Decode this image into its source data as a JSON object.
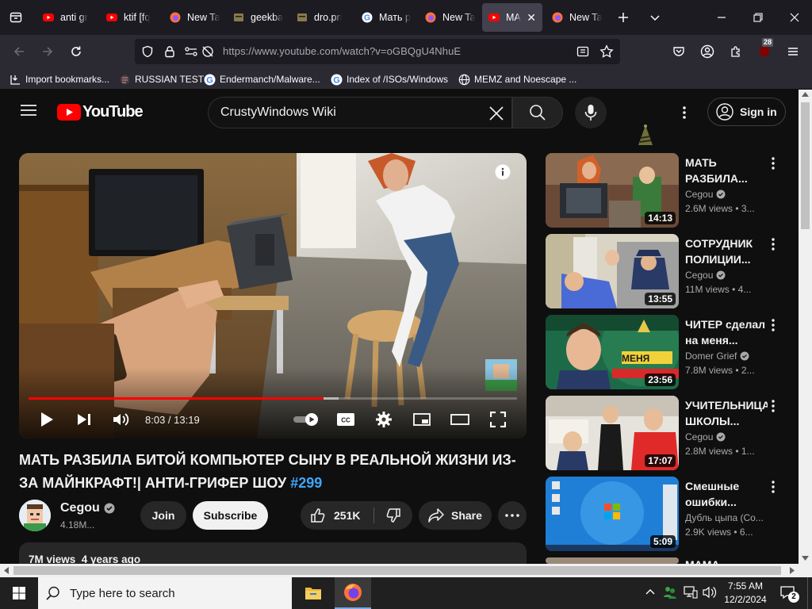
{
  "browser": {
    "tabs": [
      {
        "label": "anti gr",
        "icon": "youtube-icon"
      },
      {
        "label": "ktif [fq",
        "icon": "youtube-icon"
      },
      {
        "label": "New Ta",
        "icon": "firefox-icon"
      },
      {
        "label": "geekba",
        "icon": "page-icon"
      },
      {
        "label": "dro.pn",
        "icon": "page-icon"
      },
      {
        "label": "Мать р",
        "icon": "google-icon"
      },
      {
        "label": "New Ta",
        "icon": "firefox-icon"
      },
      {
        "label": "MA",
        "icon": "youtube-icon",
        "active": true
      },
      {
        "label": "New Ta",
        "icon": "firefox-icon"
      }
    ],
    "url": "https://www.youtube.com/watch?v=oGBQgU4NhuE",
    "extensions_badge": "28",
    "bookmarks": [
      {
        "label": "Import bookmarks...",
        "icon": "import-icon"
      },
      {
        "label": "RUSSIAN TEST",
        "icon": "page-icon"
      },
      {
        "label": "Endermanch/Malware...",
        "icon": "google-icon"
      },
      {
        "label": "Index of /ISOs/Windows",
        "icon": "google-icon"
      },
      {
        "label": "MEMZ and Noescape ...",
        "icon": "globe-icon"
      }
    ]
  },
  "youtube": {
    "logo_text": "YouTube",
    "search_value": "CrustyWindows Wiki",
    "signin_label": "Sign in",
    "player": {
      "time": "8:03 / 13:19",
      "progress": 0.604
    },
    "video": {
      "title": "МАТЬ РАЗБИЛА БИТОЙ КОМПЬЮТЕР СЫНУ В РЕАЛЬНОЙ ЖИЗНИ ИЗ-ЗА МАЙНКРАФТ!| АНТИ-ГРИФЕР ШОУ",
      "hashtag": "#299",
      "channel": "Cegou",
      "subscribers": "4.18M...",
      "join_label": "Join",
      "subscribe_label": "Subscribe",
      "likes": "251K",
      "share_label": "Share",
      "description_head": "7M views  4 years ago"
    },
    "recommendations": [
      {
        "title": "МАТЬ РАЗБИЛА...",
        "channel": "Cegou",
        "verified": true,
        "meta": "2.6M views  • 3...",
        "duration": "14:13"
      },
      {
        "title": "СОТРУДНИК ПОЛИЦИИ...",
        "channel": "Cegou",
        "verified": true,
        "meta": "11M views  • 4...",
        "duration": "13:55"
      },
      {
        "title": "ЧИТЕР сделал на меня...",
        "channel": "Domer Grief",
        "verified": true,
        "meta": "7.8M views  • 2...",
        "duration": "23:56"
      },
      {
        "title": "УЧИТЕЛЬНИЦА ШКОЛЫ...",
        "channel": "Cegou",
        "verified": true,
        "meta": "2.8M views  • 1...",
        "duration": "17:07"
      },
      {
        "title": "Смешные ошибки...",
        "channel": "Дубль цыпа (Co...",
        "verified": false,
        "meta": "2.9K views  • 6...",
        "duration": "5:09"
      },
      {
        "title": "МАМА",
        "channel": "",
        "verified": false,
        "meta": "",
        "duration": ""
      }
    ]
  },
  "taskbar": {
    "search_placeholder": "Type here to search",
    "time": "7:55 AM",
    "date": "12/2/2024",
    "notifications": "2"
  },
  "colors": {
    "youtube_red": "#ff0000",
    "accent_blue": "#3ea6ff",
    "firefox_tabbar": "#1c1b22"
  }
}
